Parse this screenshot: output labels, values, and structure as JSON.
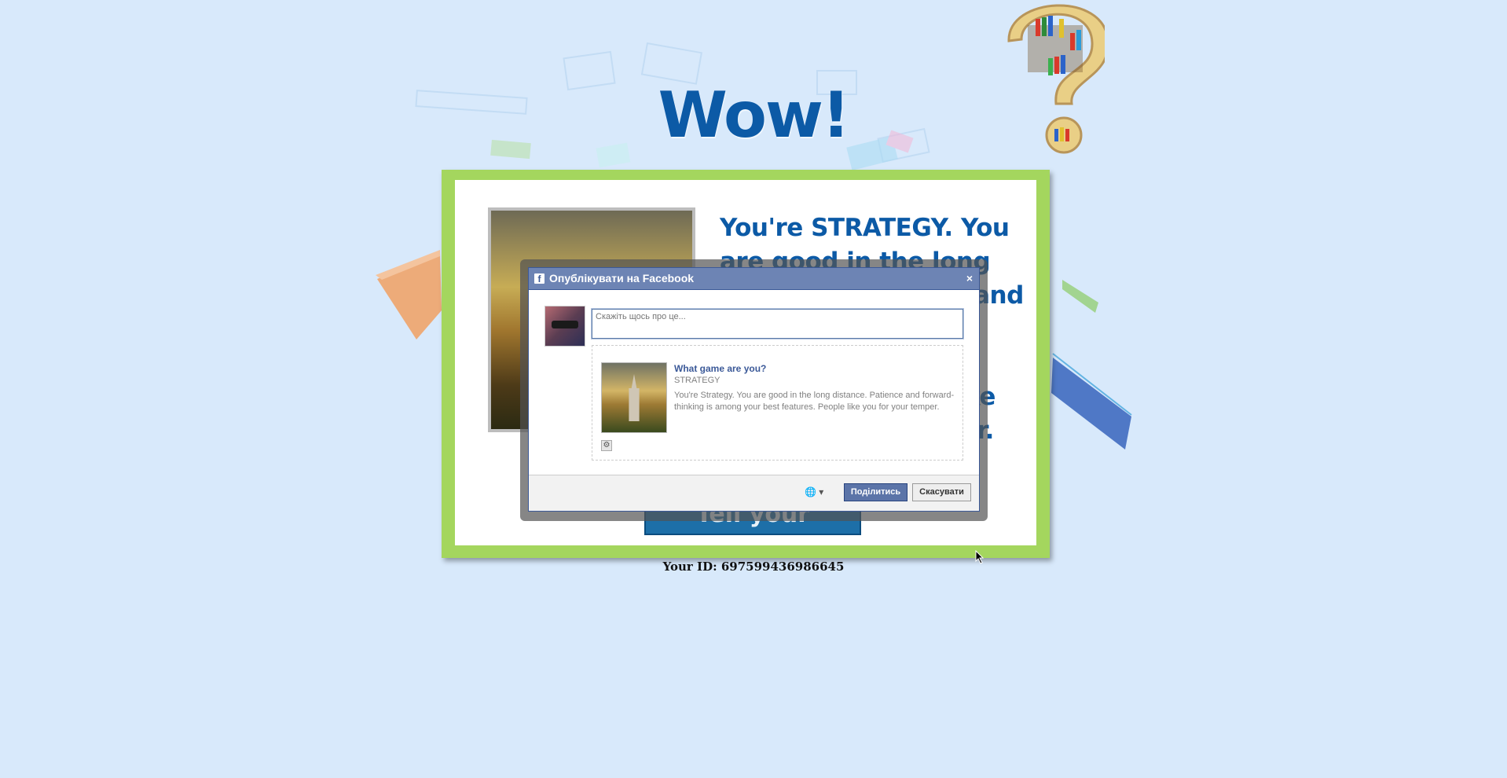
{
  "page": {
    "title": "Wow!",
    "result_text": "You're STRATEGY. You are good in the long distance. Patience and forward-thinking is among your best features. People like you for your temper.",
    "tell_friends_label": "Tell your friends!",
    "your_id": "Your ID: 697599436986645"
  },
  "dialog": {
    "title": "Опублікувати на Facebook",
    "close_glyph": "×",
    "fb_glyph": "f",
    "comment_placeholder": "Скажіть щось про це...",
    "preview": {
      "title": "What game are you?",
      "caption": "STRATEGY",
      "description": "You're Strategy. You are good in the long distance. Patience and forward-thinking is among your best features. People like you for your temper."
    },
    "privacy_icon": "globe-icon",
    "privacy_glyph": "🌐 ▾",
    "share_label": "Поділитись",
    "cancel_label": "Скасувати"
  },
  "colors": {
    "page_bg": "#d8e9fb",
    "title_blue": "#0c5aa6",
    "card_green": "#a4d65e",
    "fb_header": "#6d84b4",
    "fb_button": "#5b74a8"
  }
}
